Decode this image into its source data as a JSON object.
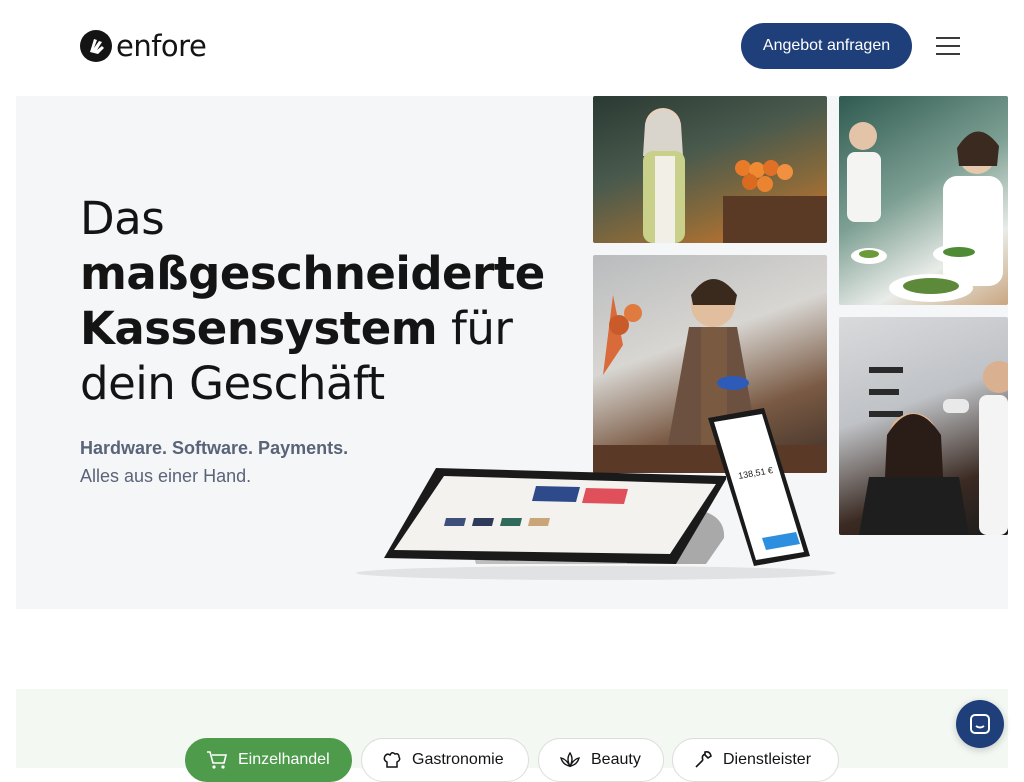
{
  "header": {
    "logo_text": "enfore",
    "cta_label": "Angebot anfragen"
  },
  "hero": {
    "headline_line1": "Das",
    "headline_line2": "maßgeschneiderte",
    "headline_line3_bold": "Kassensystem",
    "headline_line3_rest": " für",
    "headline_line4": "dein Geschäft",
    "sub_bold": "Hardware. Software. Payments.",
    "sub_text": "Alles aus einer Hand.",
    "phone_amount": "138,51 €"
  },
  "categories": [
    {
      "label": "Einzelhandel",
      "icon": "cart-icon",
      "active": true
    },
    {
      "label": "Gastronomie",
      "icon": "chef-hat-icon",
      "active": false
    },
    {
      "label": "Beauty",
      "icon": "lotus-icon",
      "active": false
    },
    {
      "label": "Dienstleister",
      "icon": "wrench-icon",
      "active": false
    }
  ],
  "colors": {
    "brand_blue": "#1f3f7a",
    "active_green": "#4e9b4c",
    "hero_bg": "#f5f6f8"
  }
}
